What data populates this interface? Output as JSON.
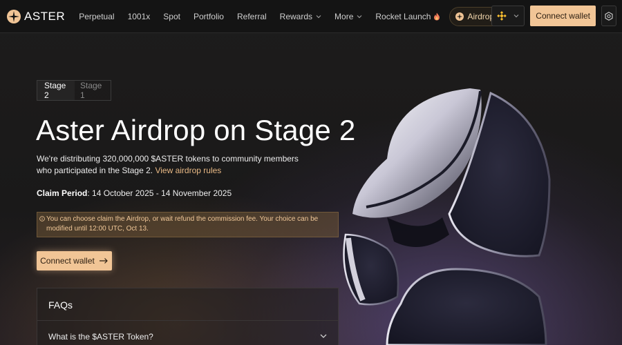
{
  "header": {
    "logo_text": "ASTER",
    "nav": [
      {
        "label": "Perpetual"
      },
      {
        "label": "1001x"
      },
      {
        "label": "Spot"
      },
      {
        "label": "Portfolio"
      },
      {
        "label": "Referral"
      },
      {
        "label": "Rewards"
      },
      {
        "label": "More"
      },
      {
        "label": "Rocket Launch"
      }
    ],
    "airdrop_label": "Airdrop",
    "connect_label": "Connect wallet"
  },
  "stage_tabs": [
    "Stage 2",
    "Stage 1"
  ],
  "hero": {
    "title": "Aster Airdrop on Stage 2",
    "desc": "We're distributing 320,000,000 $ASTER tokens to community members who participated in the Stage 2.",
    "rules_link": "View airdrop rules",
    "claim_label": "Claim Period",
    "claim_value": ": 14 October 2025 - 14 November 2025",
    "notice": "You can choose claim the Airdrop, or wait refund the commission fee. Your choice can be modified until 12:00 UTC, Oct 13.",
    "connect_label": "Connect wallet"
  },
  "faq": {
    "title": "FAQs",
    "items": [
      {
        "question": "What is the $ASTER Token?"
      }
    ]
  },
  "colors": {
    "accent": "#f1c596",
    "link": "#e8b985",
    "notice_bg": "#705637",
    "bnb": "#f3ba2f"
  },
  "icons": {
    "logo": "aster-logo-icon",
    "flame": "flame-icon",
    "coin": "aster-coin-icon",
    "chain": "bnb-chain-icon",
    "settings": "settings-icon",
    "arrow": "arrow-right-icon",
    "chevron": "chevron-down-icon",
    "info": "info-icon"
  }
}
